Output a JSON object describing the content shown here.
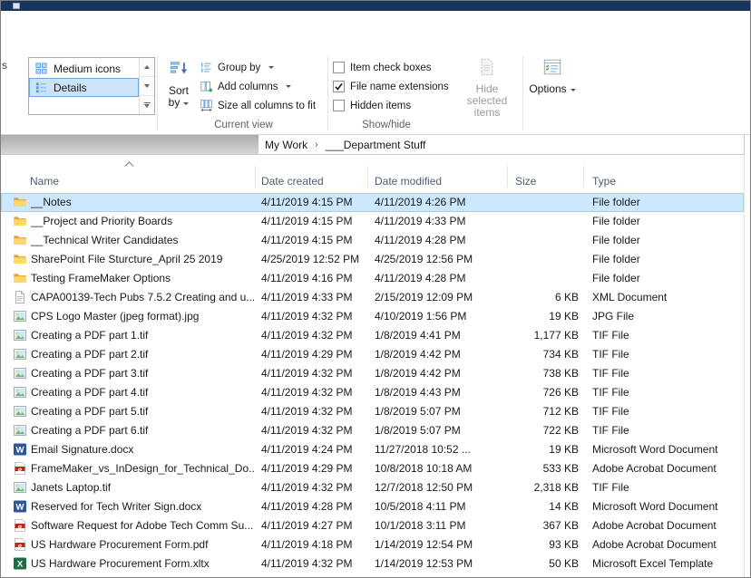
{
  "ribbon": {
    "clipped_label_fragment": "s",
    "layout_gallery": {
      "items": [
        {
          "label": "Medium icons",
          "selected": false
        },
        {
          "label": "Details",
          "selected": true
        }
      ]
    },
    "current_view": {
      "group_label": "Current view",
      "sort_by": {
        "line1": "Sort",
        "line2": "by"
      },
      "menu_items": [
        {
          "label": "Group by",
          "dropdown": true
        },
        {
          "label": "Add columns",
          "dropdown": true
        },
        {
          "label": "Size all columns to fit",
          "dropdown": false
        }
      ]
    },
    "show_hide": {
      "group_label": "Show/hide",
      "checkboxes": [
        {
          "label": "Item check boxes",
          "checked": false
        },
        {
          "label": "File name extensions",
          "checked": true
        },
        {
          "label": "Hidden items",
          "checked": false
        }
      ],
      "hide_selected": {
        "line1": "Hide selected",
        "line2": "items"
      }
    },
    "options": {
      "label": "Options"
    }
  },
  "address_bar": {
    "separator": "›",
    "breadcrumb": [
      {
        "label": "My Work"
      },
      {
        "label": "___Department Stuff"
      }
    ]
  },
  "file_list": {
    "columns": [
      {
        "label": "Name",
        "sort": "asc"
      },
      {
        "label": "Date created"
      },
      {
        "label": "Date modified"
      },
      {
        "label": "Size"
      },
      {
        "label": "Type"
      }
    ],
    "rows": [
      {
        "name": "__Notes",
        "date_created": "4/11/2019 4:15 PM",
        "date_modified": "4/11/2019 4:26 PM",
        "size": "",
        "type": "File folder",
        "icon": "folder",
        "selected": true
      },
      {
        "name": "__Project and Priority Boards",
        "date_created": "4/11/2019 4:15 PM",
        "date_modified": "4/11/2019 4:33 PM",
        "size": "",
        "type": "File folder",
        "icon": "folder"
      },
      {
        "name": "__Technical Writer Candidates",
        "date_created": "4/11/2019 4:15 PM",
        "date_modified": "4/11/2019 4:28 PM",
        "size": "",
        "type": "File folder",
        "icon": "folder"
      },
      {
        "name": "SharePoint File Sturcture_April 25 2019",
        "date_created": "4/25/2019 12:52 PM",
        "date_modified": "4/25/2019 12:56 PM",
        "size": "",
        "type": "File folder",
        "icon": "folder"
      },
      {
        "name": "Testing FrameMaker Options",
        "date_created": "4/11/2019 4:16 PM",
        "date_modified": "4/11/2019 4:28 PM",
        "size": "",
        "type": "File folder",
        "icon": "folder"
      },
      {
        "name": "CAPA00139-Tech Pubs 7.5.2 Creating and u...",
        "date_created": "4/11/2019 4:33 PM",
        "date_modified": "2/15/2019 12:09 PM",
        "size": "6 KB",
        "type": "XML Document",
        "icon": "xml"
      },
      {
        "name": "CPS Logo Master (jpeg format).jpg",
        "date_created": "4/11/2019 4:32 PM",
        "date_modified": "4/10/2019 1:56 PM",
        "size": "19 KB",
        "type": "JPG File",
        "icon": "image"
      },
      {
        "name": "Creating a PDF part 1.tif",
        "date_created": "4/11/2019 4:32 PM",
        "date_modified": "1/8/2019 4:41 PM",
        "size": "1,177 KB",
        "type": "TIF File",
        "icon": "image"
      },
      {
        "name": "Creating a PDF part 2.tif",
        "date_created": "4/11/2019 4:29 PM",
        "date_modified": "1/8/2019 4:42 PM",
        "size": "734 KB",
        "type": "TIF File",
        "icon": "image"
      },
      {
        "name": "Creating a PDF part 3.tif",
        "date_created": "4/11/2019 4:32 PM",
        "date_modified": "1/8/2019 4:42 PM",
        "size": "738 KB",
        "type": "TIF File",
        "icon": "image"
      },
      {
        "name": "Creating a PDF part 4.tif",
        "date_created": "4/11/2019 4:32 PM",
        "date_modified": "1/8/2019 4:43 PM",
        "size": "726 KB",
        "type": "TIF File",
        "icon": "image"
      },
      {
        "name": "Creating a PDF part 5.tif",
        "date_created": "4/11/2019 4:32 PM",
        "date_modified": "1/8/2019 5:07 PM",
        "size": "712 KB",
        "type": "TIF File",
        "icon": "image"
      },
      {
        "name": "Creating a PDF part 6.tif",
        "date_created": "4/11/2019 4:32 PM",
        "date_modified": "1/8/2019 5:07 PM",
        "size": "722 KB",
        "type": "TIF File",
        "icon": "image"
      },
      {
        "name": "Email Signature.docx",
        "date_created": "4/11/2019 4:24 PM",
        "date_modified": "11/27/2018 10:52 ...",
        "size": "19 KB",
        "type": "Microsoft Word Document",
        "icon": "word"
      },
      {
        "name": "FrameMaker_vs_InDesign_for_Technical_Do...",
        "date_created": "4/11/2019 4:29 PM",
        "date_modified": "10/8/2018 10:18 AM",
        "size": "533 KB",
        "type": "Adobe Acrobat Document",
        "icon": "pdf"
      },
      {
        "name": "Janets Laptop.tif",
        "date_created": "4/11/2019 4:32 PM",
        "date_modified": "12/7/2018 12:50 PM",
        "size": "2,318 KB",
        "type": "TIF File",
        "icon": "image"
      },
      {
        "name": "Reserved for Tech Writer Sign.docx",
        "date_created": "4/11/2019 4:28 PM",
        "date_modified": "10/5/2018 4:11 PM",
        "size": "14 KB",
        "type": "Microsoft Word Document",
        "icon": "word"
      },
      {
        "name": "Software Request for Adobe Tech Comm Su...",
        "date_created": "4/11/2019 4:27 PM",
        "date_modified": "10/1/2018 3:11 PM",
        "size": "367 KB",
        "type": "Adobe Acrobat Document",
        "icon": "pdf"
      },
      {
        "name": "US Hardware Procurement Form.pdf",
        "date_created": "4/11/2019 4:18 PM",
        "date_modified": "1/14/2019 12:54 PM",
        "size": "93 KB",
        "type": "Adobe Acrobat Document",
        "icon": "pdf"
      },
      {
        "name": "US Hardware Procurement Form.xltx",
        "date_created": "4/11/2019 4:32 PM",
        "date_modified": "1/14/2019 12:53 PM",
        "size": "50 KB",
        "type": "Microsoft Excel Template",
        "icon": "excel"
      }
    ]
  }
}
